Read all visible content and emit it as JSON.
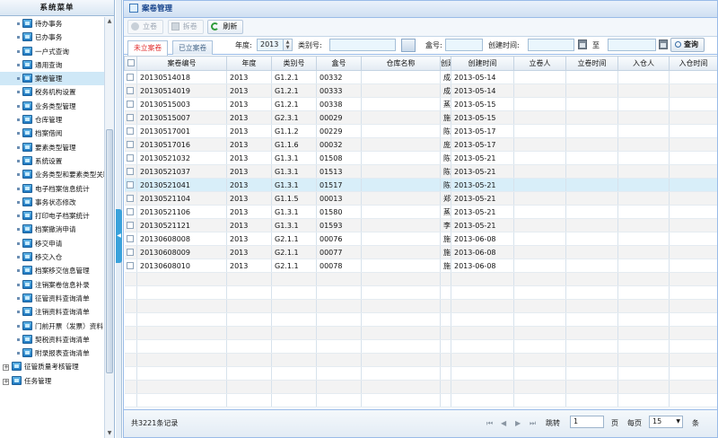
{
  "sidebar": {
    "title": "系统菜单",
    "items": [
      {
        "label": "待办事务",
        "type": "item"
      },
      {
        "label": "已办事务",
        "type": "item"
      },
      {
        "label": "一户式查询",
        "type": "item"
      },
      {
        "label": "通用查询",
        "type": "item"
      },
      {
        "label": "案卷管理",
        "type": "item",
        "selected": true
      },
      {
        "label": "税务机构设置",
        "type": "item"
      },
      {
        "label": "业务类型管理",
        "type": "item"
      },
      {
        "label": "仓库管理",
        "type": "item"
      },
      {
        "label": "档案借阅",
        "type": "item"
      },
      {
        "label": "要素类型管理",
        "type": "item"
      },
      {
        "label": "系统设置",
        "type": "item"
      },
      {
        "label": "业务类型和要素类型关联",
        "type": "item"
      },
      {
        "label": "电子档案信息统计",
        "type": "item"
      },
      {
        "label": "事务状态修改",
        "type": "item"
      },
      {
        "label": "打印电子档案统计",
        "type": "item"
      },
      {
        "label": "档案撤消申请",
        "type": "item"
      },
      {
        "label": "移交申请",
        "type": "item"
      },
      {
        "label": "移交入仓",
        "type": "item"
      },
      {
        "label": "档案移交信息管理",
        "type": "item"
      },
      {
        "label": "注销案卷信息补录",
        "type": "item"
      },
      {
        "label": "征管资料查询清单",
        "type": "item"
      },
      {
        "label": "注销资料查询清单",
        "type": "item"
      },
      {
        "label": "门前开票（发票）资料",
        "type": "item"
      },
      {
        "label": "契税资料查询清单",
        "type": "item"
      },
      {
        "label": "附录报表查询清单",
        "type": "item"
      },
      {
        "label": "征管质量考核管理",
        "type": "group"
      },
      {
        "label": "任务管理",
        "type": "group"
      }
    ]
  },
  "panel": {
    "title": "案卷管理"
  },
  "toolbar": {
    "add": "立卷",
    "split": "拆卷",
    "refresh": "刷新"
  },
  "tabs": {
    "pending": "未立案卷",
    "done": "已立案卷"
  },
  "filter": {
    "year_label": "年度:",
    "year_value": "2013",
    "category_label": "类别号:",
    "category_value": "",
    "box_label": "盒号:",
    "box_value": "",
    "ctime_label": "创建时间:",
    "ctime_from": "",
    "to_label": "至",
    "ctime_to": "",
    "query": "查询"
  },
  "grid": {
    "columns": [
      "案卷编号",
      "年度",
      "类别号",
      "盒号",
      "仓库名称",
      "创建人",
      "创建时间",
      "立卷人",
      "立卷时间",
      "入仓人",
      "入仓时间"
    ],
    "rows": [
      [
        "20130514018",
        "2013",
        "G1.2.1",
        "00332",
        "",
        "成",
        "2013-05-14",
        "",
        "",
        "",
        ""
      ],
      [
        "20130514019",
        "2013",
        "G1.2.1",
        "00333",
        "",
        "成",
        "2013-05-14",
        "",
        "",
        "",
        ""
      ],
      [
        "20130515003",
        "2013",
        "G1.2.1",
        "00338",
        "",
        "蒸",
        "2013-05-15",
        "",
        "",
        "",
        ""
      ],
      [
        "20130515007",
        "2013",
        "G2.3.1",
        "00029",
        "",
        "施",
        "2013-05-15",
        "",
        "",
        "",
        ""
      ],
      [
        "20130517001",
        "2013",
        "G1.1.2",
        "00229",
        "",
        "陈",
        "2013-05-17",
        "",
        "",
        "",
        ""
      ],
      [
        "20130517016",
        "2013",
        "G1.1.6",
        "00032",
        "",
        "庞",
        "2013-05-17",
        "",
        "",
        "",
        ""
      ],
      [
        "20130521032",
        "2013",
        "G1.3.1",
        "01508",
        "",
        "陈",
        "2013-05-21",
        "",
        "",
        "",
        ""
      ],
      [
        "20130521037",
        "2013",
        "G1.3.1",
        "01513",
        "",
        "陈",
        "2013-05-21",
        "",
        "",
        "",
        ""
      ],
      [
        "20130521041",
        "2013",
        "G1.3.1",
        "01517",
        "",
        "陈",
        "2013-05-21",
        "",
        "",
        "",
        ""
      ],
      [
        "20130521104",
        "2013",
        "G1.1.5",
        "00013",
        "",
        "郑",
        "2013-05-21",
        "",
        "",
        "",
        ""
      ],
      [
        "20130521106",
        "2013",
        "G1.3.1",
        "01580",
        "",
        "蒸",
        "2013-05-21",
        "",
        "",
        "",
        ""
      ],
      [
        "20130521121",
        "2013",
        "G1.3.1",
        "01593",
        "",
        "李",
        "2013-05-21",
        "",
        "",
        "",
        ""
      ],
      [
        "20130608008",
        "2013",
        "G2.1.1",
        "00076",
        "",
        "施",
        "2013-06-08",
        "",
        "",
        "",
        ""
      ],
      [
        "20130608009",
        "2013",
        "G2.1.1",
        "00077",
        "",
        "施",
        "2013-06-08",
        "",
        "",
        "",
        ""
      ],
      [
        "20130608010",
        "2013",
        "G2.1.1",
        "00078",
        "",
        "施",
        "2013-06-08",
        "",
        "",
        "",
        ""
      ]
    ],
    "selected_row": 8
  },
  "footer": {
    "total": "共3221条记录",
    "goto_label": "跳转",
    "page_value": "1",
    "page_unit": "页",
    "per_page_label": "每页",
    "per_page_value": "15",
    "per_page_unit": "条"
  },
  "colors": {
    "accent": "#15428b",
    "selected_row": "#d8eef9",
    "input_bg": "#eaf6fd",
    "active_tab_text": "#e03030"
  }
}
